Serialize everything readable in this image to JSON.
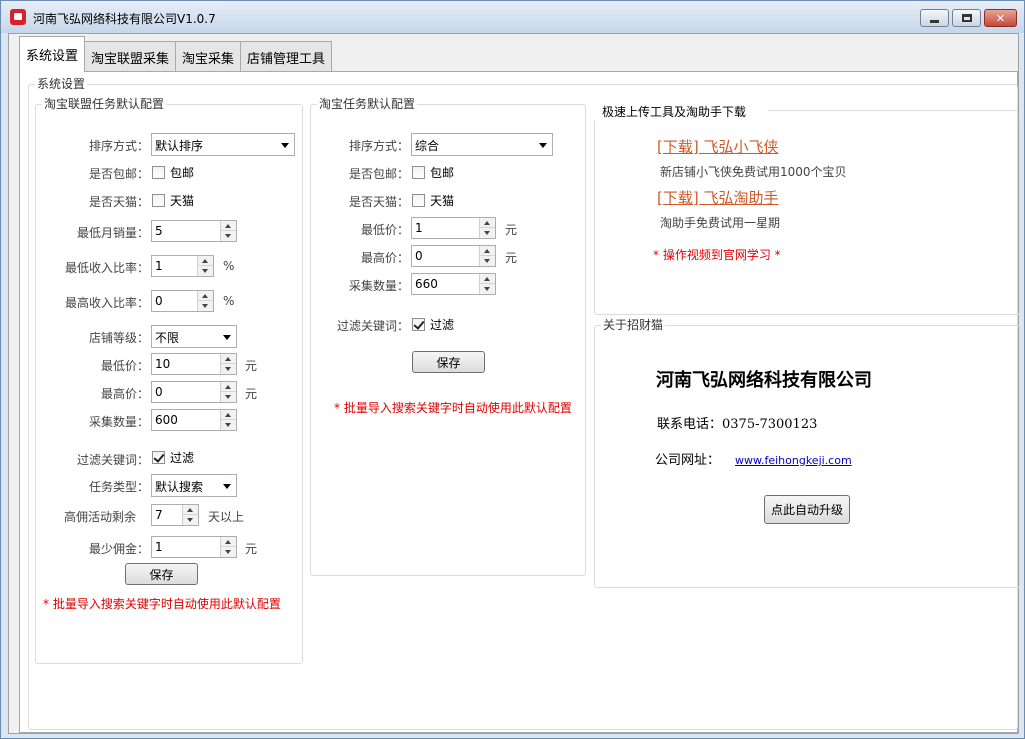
{
  "window": {
    "title": "河南飞弘网络科技有限公司V1.0.7"
  },
  "tabs": [
    {
      "label": "系统设置",
      "active": true
    },
    {
      "label": "淘宝联盟采集",
      "active": false
    },
    {
      "label": "淘宝采集",
      "active": false
    },
    {
      "label": "店铺管理工具",
      "active": false
    }
  ],
  "outer_group": {
    "title": "系统设置"
  },
  "alliance": {
    "title": "淘宝联盟任务默认配置",
    "sort_label": "排序方式：",
    "sort_value": "默认排序",
    "free_ship_label": "是否包邮：",
    "free_ship_text": "包邮",
    "free_ship_checked": false,
    "tmall_label": "是否天猫：",
    "tmall_text": "天猫",
    "tmall_checked": false,
    "min_sales_label": "最低月销量：",
    "min_sales_value": "5",
    "min_ratio_label": "最低收入比率：",
    "min_ratio_value": "1",
    "min_ratio_unit": "%",
    "max_ratio_label": "最高收入比率：",
    "max_ratio_value": "0",
    "max_ratio_unit": "%",
    "shop_level_label": "店铺等级：",
    "shop_level_value": "不限",
    "min_price_label": "最低价：",
    "min_price_value": "10",
    "min_price_unit": "元",
    "max_price_label": "最高价：",
    "max_price_value": "0",
    "max_price_unit": "元",
    "count_label": "采集数量：",
    "count_value": "600",
    "filter_label": "过滤关键词：",
    "filter_text": "过滤",
    "filter_checked": true,
    "task_type_label": "任务类型：",
    "task_type_value": "默认搜索",
    "activity_label": "高佣活动剩余",
    "activity_value": "7",
    "activity_unit": "天以上",
    "min_commission_label": "最少佣金：",
    "min_commission_value": "1",
    "min_commission_unit": "元",
    "save_label": "保存",
    "note": "* 批量导入搜索关键字时自动使用此默认配置"
  },
  "taobao": {
    "title": "淘宝任务默认配置",
    "sort_label": "排序方式：",
    "sort_value": "综合",
    "free_ship_label": "是否包邮：",
    "free_ship_text": "包邮",
    "free_ship_checked": false,
    "tmall_label": "是否天猫：",
    "tmall_text": "天猫",
    "tmall_checked": false,
    "min_price_label": "最低价：",
    "min_price_value": "1",
    "min_price_unit": "元",
    "max_price_label": "最高价：",
    "max_price_value": "0",
    "max_price_unit": "元",
    "count_label": "采集数量：",
    "count_value": "660",
    "filter_label": "过滤关键词：",
    "filter_text": "过滤",
    "filter_checked": true,
    "save_label": "保存",
    "note": "* 批量导入搜索关键字时自动使用此默认配置"
  },
  "download": {
    "title": "极速上传工具及淘助手下载",
    "link1": "[下载] 飞弘小飞侠",
    "desc1": "新店铺小飞侠免费试用1000个宝贝",
    "link2": "[下载] 飞弘淘助手",
    "desc2": "淘助手免费试用一星期",
    "note": "* 操作视频到官网学习 *"
  },
  "about": {
    "title": "关于招财猫",
    "company": "河南飞弘网络科技有限公司",
    "phone": "联系电话：0375-7300123",
    "site_label": "公司网址：",
    "site_url": "www.feihongkeji.com",
    "upgrade_label": "点此自动升级"
  },
  "colors": {
    "note_red": "#e00000",
    "link_orange": "#d0592a",
    "url_blue": "#0000cc"
  }
}
